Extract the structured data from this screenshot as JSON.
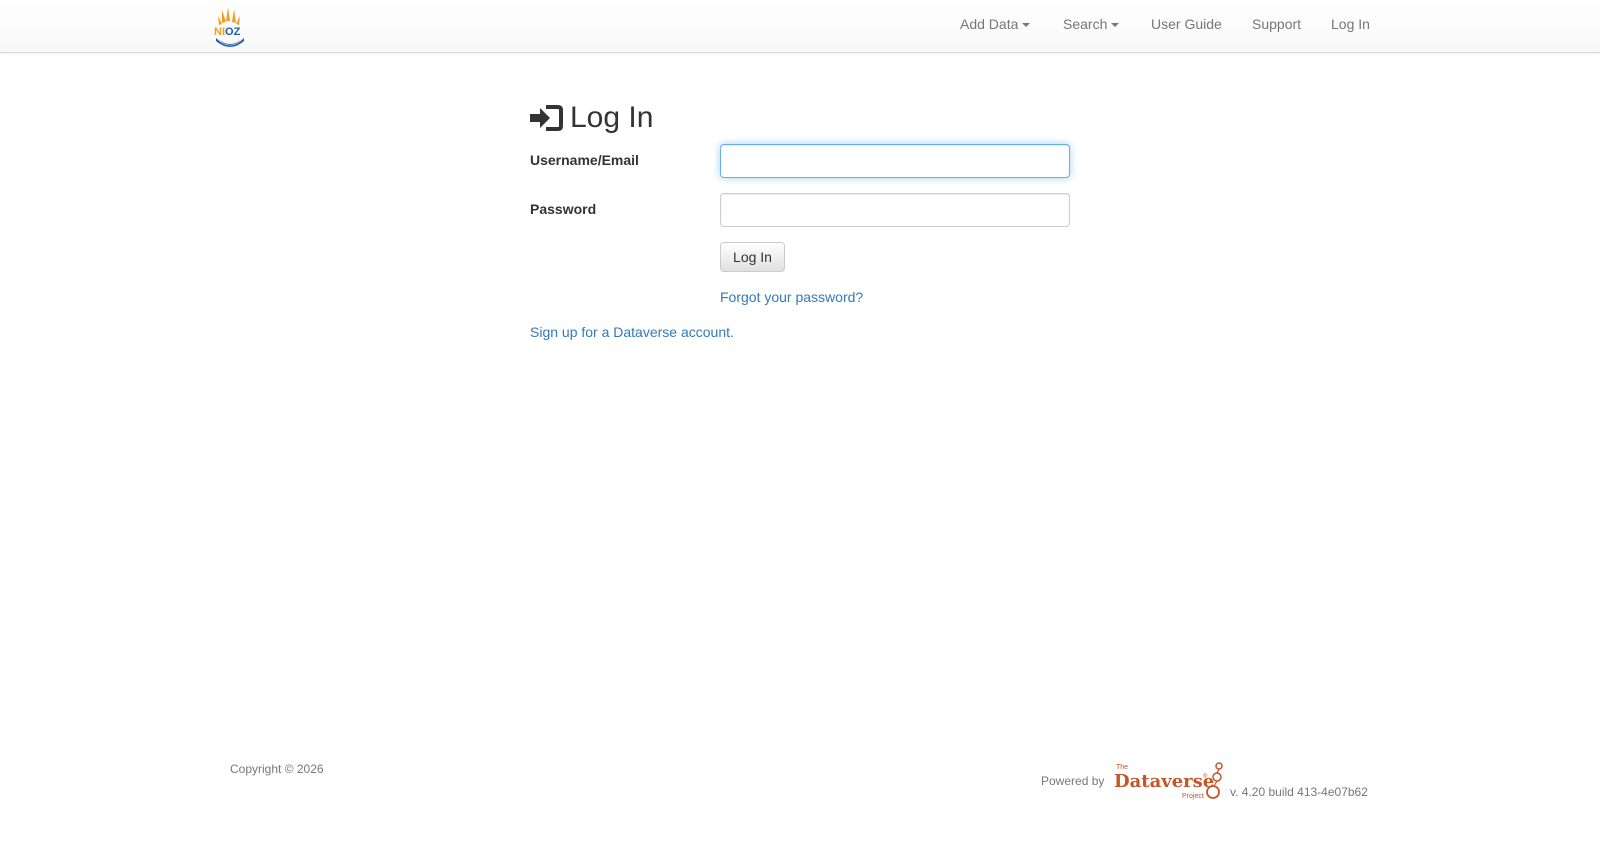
{
  "header": {
    "logo_text": "NIOZ",
    "nav": {
      "add_data": "Add Data",
      "search": "Search",
      "user_guide": "User Guide",
      "support": "Support",
      "log_in": "Log In"
    }
  },
  "main": {
    "title": "Log In",
    "username_label": "Username/Email",
    "username_value": "",
    "password_label": "Password",
    "password_value": "",
    "login_button": "Log In",
    "forgot_password": "Forgot your password?",
    "signup": "Sign up for a Dataverse account."
  },
  "footer": {
    "copyright": "Copyright © 2026",
    "powered_by": "Powered by",
    "logo_the": "The",
    "logo_name": "Dataverse",
    "logo_reg": "®",
    "logo_project": "Project",
    "version": "v. 4.20 build 413-4e07b62"
  },
  "colors": {
    "link": "#337ab7",
    "nav_text": "#777777",
    "nioz_orange": "#f0a020",
    "nioz_blue": "#1b5fa8",
    "dataverse_orange": "#c5562a"
  },
  "icons": [
    "sign-in-icon",
    "caret-down-icon"
  ]
}
